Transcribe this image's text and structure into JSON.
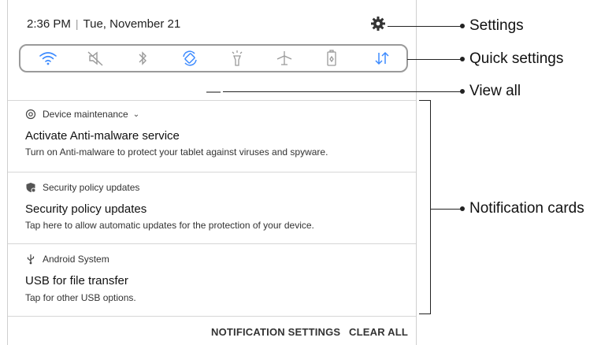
{
  "status": {
    "time": "2:36 PM",
    "separator": "|",
    "date": "Tue, November 21"
  },
  "quick_settings": {
    "tiles": [
      {
        "icon": "wifi-icon",
        "active": true
      },
      {
        "icon": "mute-icon",
        "active": false
      },
      {
        "icon": "bluetooth-icon",
        "active": false
      },
      {
        "icon": "auto-rotate-icon",
        "active": true
      },
      {
        "icon": "flashlight-icon",
        "active": false
      },
      {
        "icon": "airplane-icon",
        "active": false
      },
      {
        "icon": "power-saving-icon",
        "active": false
      },
      {
        "icon": "mobile-data-icon",
        "active": true
      }
    ],
    "colors": {
      "active": "#3d8bff",
      "inactive": "#9a9a9a"
    }
  },
  "notifications": [
    {
      "app": "Device maintenance",
      "app_icon": "device-maintenance-icon",
      "title": "Activate Anti-malware service",
      "body": "Turn on Anti-malware to protect your tablet against viruses and spyware."
    },
    {
      "app": "Security policy updates",
      "app_icon": "shield-icon",
      "title": "Security policy updates",
      "body": "Tap here to allow automatic updates for the protection of your device."
    },
    {
      "app": "Android System",
      "app_icon": "usb-icon",
      "title": "USB for file transfer",
      "body": "Tap for other USB options."
    }
  ],
  "actions": {
    "notification_settings": "NOTIFICATION SETTINGS",
    "clear_all": "CLEAR ALL"
  },
  "callouts": {
    "settings": "Settings",
    "quick_settings": "Quick settings",
    "view_all": "View all",
    "notification_cards": "Notification cards"
  }
}
